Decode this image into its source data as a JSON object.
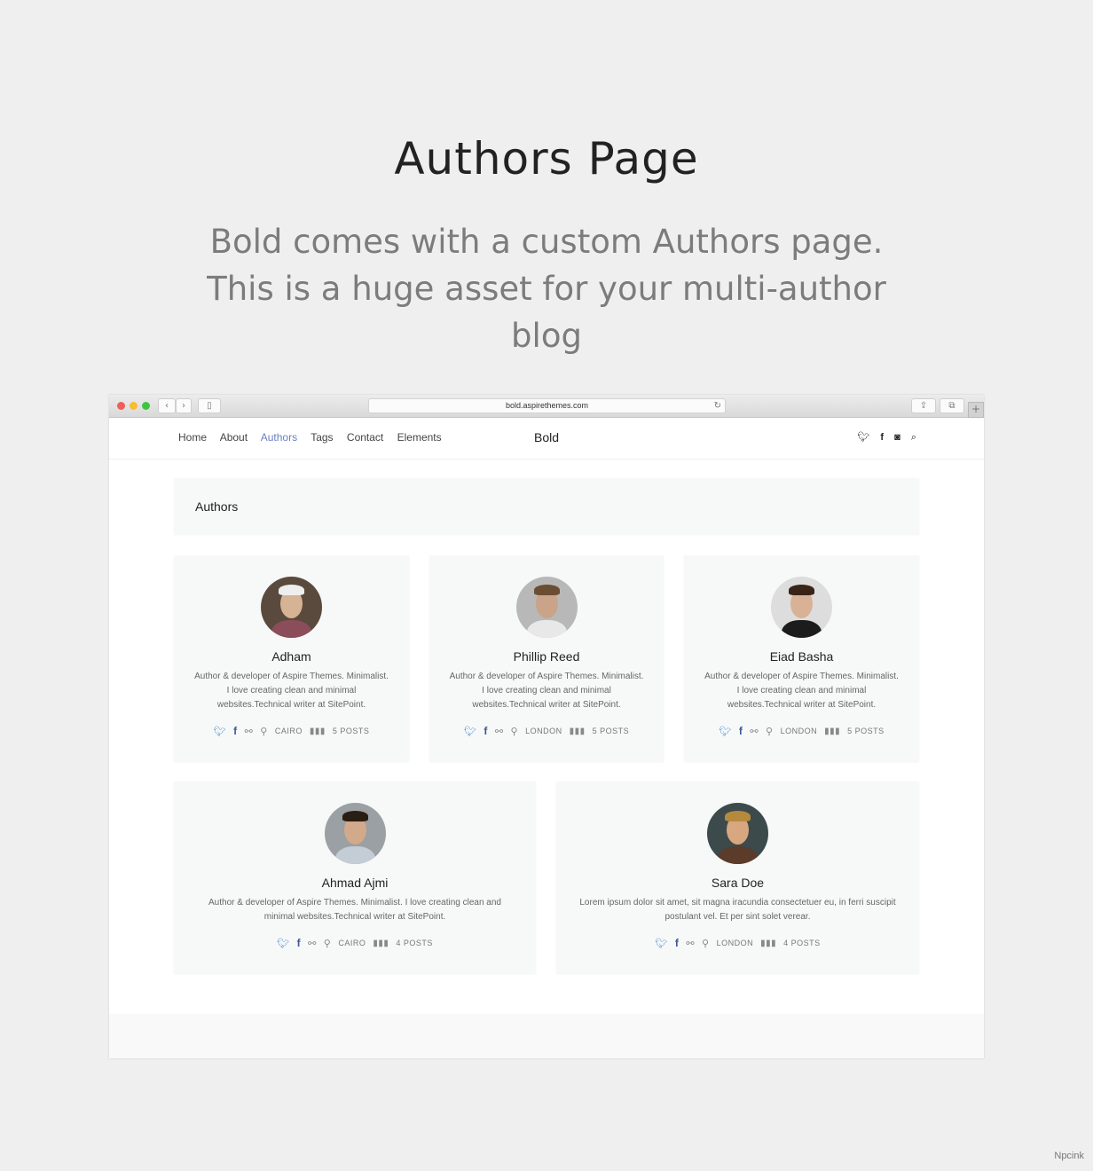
{
  "hero": {
    "title": "Authors Page",
    "subtitle": "Bold comes with a custom Authors page. This is a huge asset for your multi-author blog"
  },
  "browser": {
    "url": "bold.aspirethemes.com"
  },
  "nav": {
    "links": [
      "Home",
      "About",
      "Authors",
      "Tags",
      "Contact",
      "Elements"
    ],
    "active": "Authors",
    "brand": "Bold",
    "social_icons": [
      "twitter-icon",
      "facebook-icon",
      "instagram-icon",
      "search-icon"
    ]
  },
  "page": {
    "header": "Authors"
  },
  "authors": [
    {
      "name": "Adham",
      "bio": "Author & developer of Aspire Themes. Minimalist. I love creating clean and minimal websites.Technical writer at SitePoint.",
      "location": "CAIRO",
      "posts": "5 POSTS"
    },
    {
      "name": "Phillip Reed",
      "bio": "Author & developer of Aspire Themes. Minimalist. I love creating clean and minimal websites.Technical writer at SitePoint.",
      "location": "LONDON",
      "posts": "5 POSTS"
    },
    {
      "name": "Eiad Basha",
      "bio": "Author & developer of Aspire Themes. Minimalist. I love creating clean and minimal websites.Technical writer at SitePoint.",
      "location": "LONDON",
      "posts": "5 POSTS"
    },
    {
      "name": "Ahmad Ajmi",
      "bio": "Author & developer of Aspire Themes. Minimalist. I love creating clean and minimal websites.Technical writer at SitePoint.",
      "location": "CAIRO",
      "posts": "4 POSTS"
    },
    {
      "name": "Sara Doe",
      "bio": "Lorem ipsum dolor sit amet, sit magna iracundia consectetuer eu, in ferri suscipit postulant vel. Et per sint solet verear.",
      "location": "LONDON",
      "posts": "4 POSTS"
    }
  ],
  "watermark": "Npcink",
  "colors": {
    "accent": "#6b7fc3",
    "twitter": "#4a8fd6",
    "facebook": "#3b5998",
    "background": "#efefef",
    "card": "#f7f8f8"
  }
}
